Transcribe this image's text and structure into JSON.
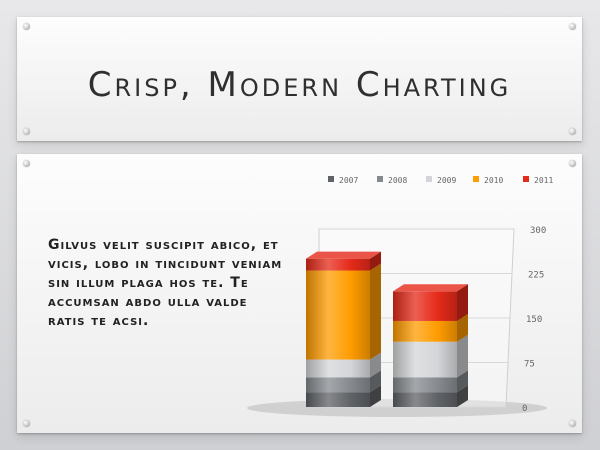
{
  "title": "Crisp, Modern Charting",
  "body_text": "Gilvus velit suscipit abico, et vicis, lobo in tincidunt veniam sin illum plaga hos te. Te accumsan abdo ulla valde ratis te acsi.",
  "chart_data": {
    "type": "bar",
    "stacked": true,
    "three_d": true,
    "categories": [
      "",
      ""
    ],
    "series": [
      {
        "name": "2007",
        "color": "#5f6266",
        "values": [
          25,
          25
        ]
      },
      {
        "name": "2008",
        "color": "#868a8f",
        "values": [
          25,
          25
        ]
      },
      {
        "name": "2009",
        "color": "#d3d5d8",
        "values": [
          30,
          60
        ]
      },
      {
        "name": "2010",
        "color": "#ff9c00",
        "values": [
          150,
          35
        ]
      },
      {
        "name": "2011",
        "color": "#e52a1a",
        "values": [
          20,
          50
        ]
      }
    ],
    "yticks": [
      "0",
      "75",
      "150",
      "225",
      "300"
    ],
    "ylim": [
      0,
      300
    ],
    "legend": "top-right"
  }
}
